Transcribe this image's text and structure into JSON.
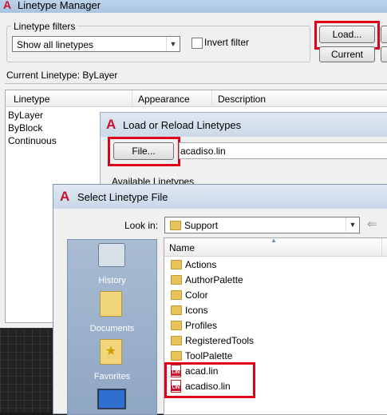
{
  "linetype_manager": {
    "title": "Linetype Manager",
    "filters_group": "Linetype filters",
    "filter_value": "Show all linetypes",
    "invert_filter": "Invert filter",
    "load_button": "Load...",
    "current_button": "Current",
    "current_linetype": "Current Linetype:  ByLayer",
    "columns": [
      "Linetype",
      "Appearance",
      "Description"
    ],
    "rows": [
      "ByLayer",
      "ByBlock",
      "Continuous"
    ]
  },
  "load_dialog": {
    "title": "Load or Reload Linetypes",
    "file_button": "File...",
    "file_value": "acadiso.lin",
    "available_label": "Available Linetypes"
  },
  "select_dialog": {
    "title": "Select Linetype File",
    "look_in_label": "Look in:",
    "look_in_value": "Support",
    "name_header": "Name",
    "places": [
      "History",
      "Documents",
      "Favorites"
    ],
    "folders": [
      "Actions",
      "AuthorPalette",
      "Color",
      "Icons",
      "Profiles",
      "RegisteredTools",
      "ToolPalette"
    ],
    "files": [
      "acad.lin",
      "acadiso.lin"
    ],
    "lin_badge": "LIN"
  },
  "colors": {
    "highlight_red": "#e0001b",
    "autocad_red": "#c8102e"
  }
}
